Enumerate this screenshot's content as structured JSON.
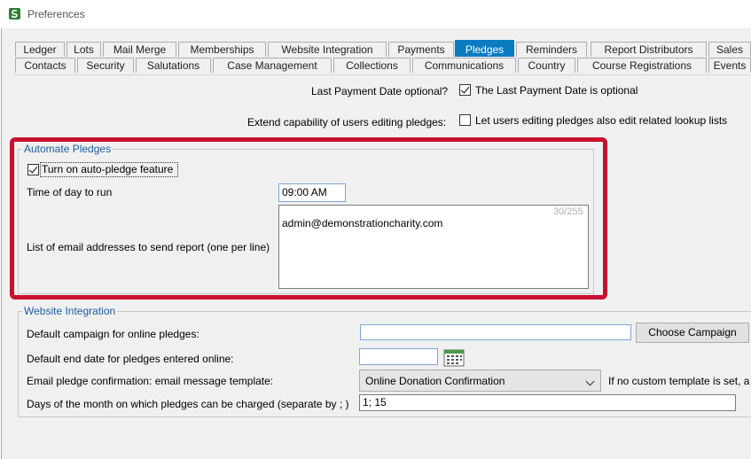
{
  "window": {
    "title": "Preferences",
    "app_icon": "app-logo-icon"
  },
  "tabs_row1": [
    "Ledger",
    "Lots",
    "Mail Merge",
    "Memberships",
    "Website Integration",
    "Payments",
    "Pledges",
    "Reminders",
    "Report Distributors",
    "Sales"
  ],
  "tabs_row2": [
    "Contacts",
    "Security",
    "Salutations",
    "Case Management",
    "Collections",
    "Communications",
    "Country",
    "Course Registrations",
    "Events"
  ],
  "active_tab": "Pledges",
  "options": {
    "last_payment_label": "Last Payment Date optional?",
    "last_payment_checkbox": "The Last Payment Date is optional",
    "last_payment_checked": true,
    "extend_label": "Extend capability of users editing pledges:",
    "extend_checkbox": "Let users editing pledges also edit related lookup lists",
    "extend_checked": false
  },
  "automate": {
    "legend": "Automate Pledges",
    "auto_checkbox": "Turn on auto-pledge feature",
    "auto_checked": true,
    "time_label": "Time of day to run",
    "time_value": "09:00 AM",
    "emails_label": "List of email addresses to send report (one per line)",
    "emails_value": "admin@demonstrationcharity.com",
    "char_count": "30/255"
  },
  "website": {
    "legend": "Website Integration",
    "campaign_label": "Default campaign for online pledges:",
    "campaign_value": "",
    "choose_campaign": "Choose Campaign",
    "end_date_label": "Default end date for pledges entered online:",
    "end_date_value": "",
    "template_label": "Email pledge confirmation: email message template:",
    "template_value": "Online Donation Confirmation",
    "template_note": "If no custom template is set, a",
    "days_label": "Days of the month on which pledges can be charged (separate by ; )",
    "days_value": "1; 15"
  },
  "colors": {
    "active_tab": "#0a7bc0",
    "highlight": "#c8102e",
    "legend": "#1a5fa8"
  }
}
